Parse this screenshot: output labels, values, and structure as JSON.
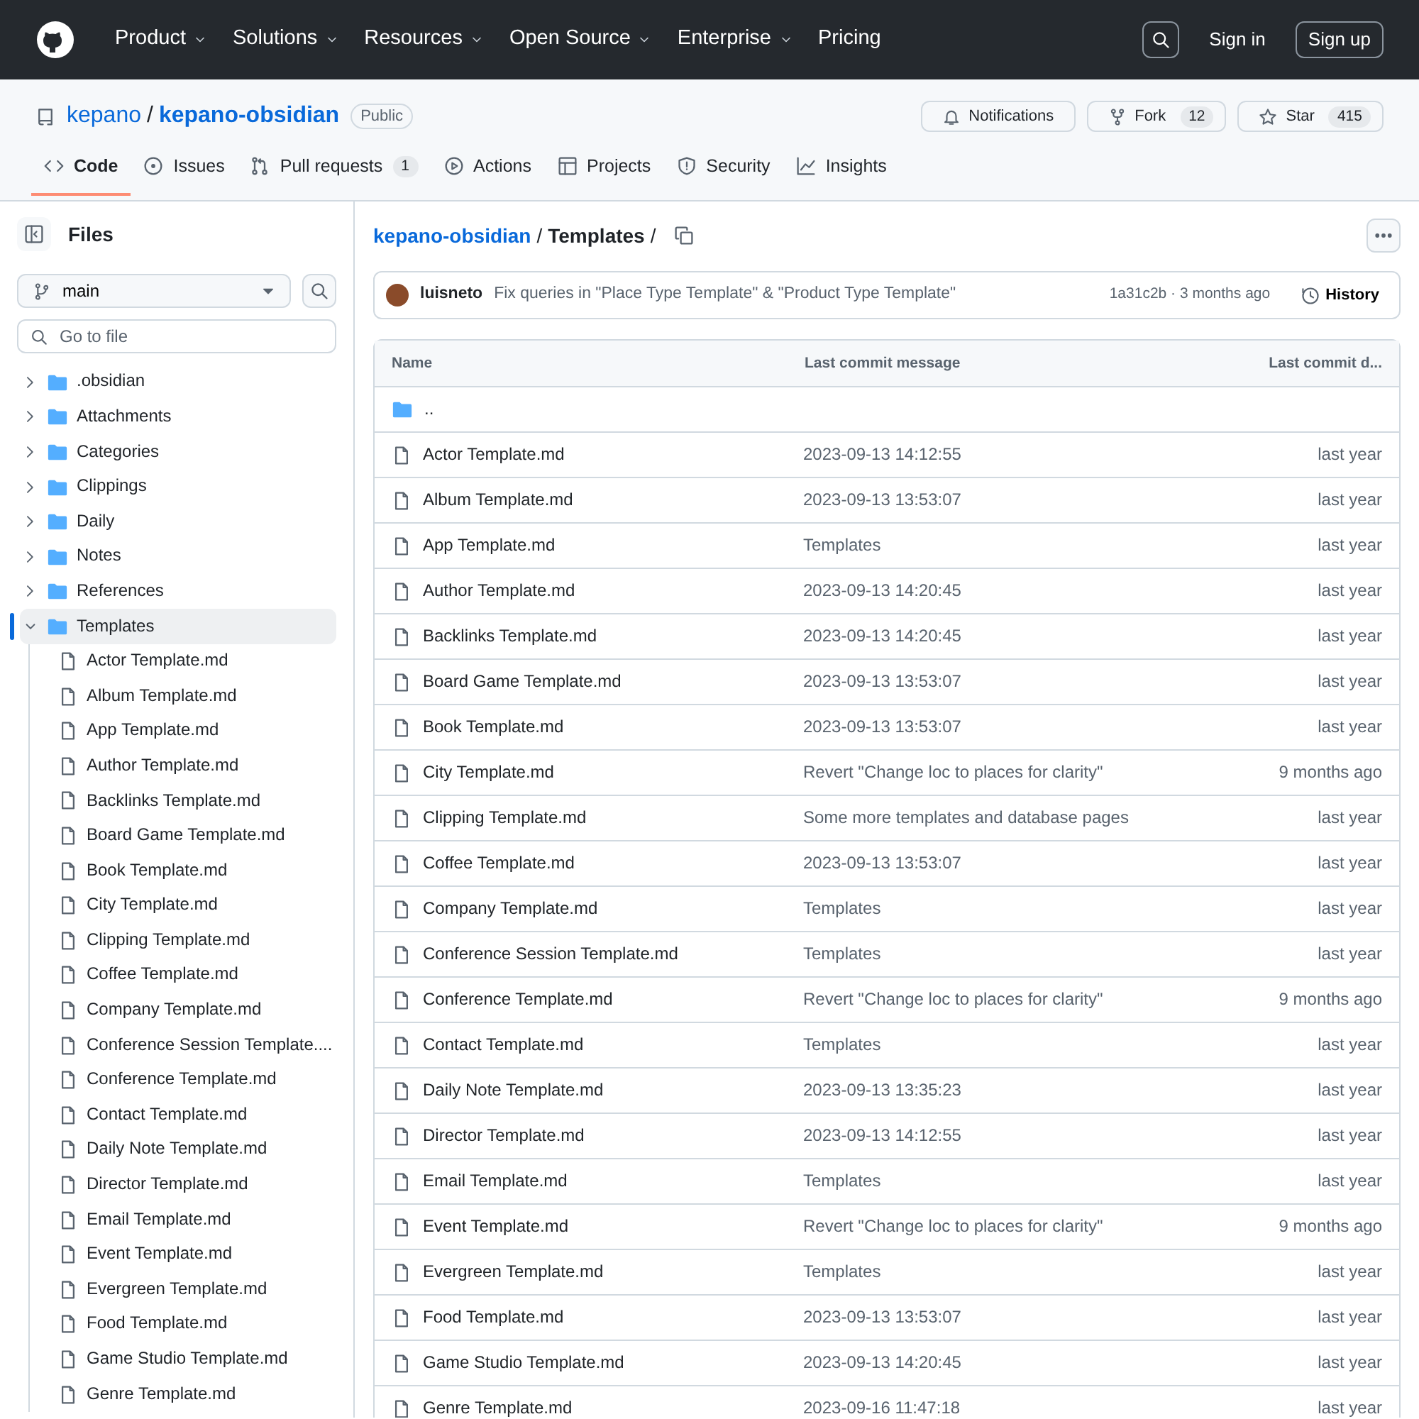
{
  "nav": {
    "items": [
      {
        "label": "Product",
        "dropdown": true
      },
      {
        "label": "Solutions",
        "dropdown": true
      },
      {
        "label": "Resources",
        "dropdown": true
      },
      {
        "label": "Open Source",
        "dropdown": true
      },
      {
        "label": "Enterprise",
        "dropdown": true
      },
      {
        "label": "Pricing",
        "dropdown": false
      }
    ],
    "sign_in": "Sign in",
    "sign_up": "Sign up"
  },
  "repo": {
    "owner": "kepano",
    "separator": "/",
    "name": "kepano-obsidian",
    "visibility": "Public",
    "notifications": "Notifications",
    "fork": {
      "label": "Fork",
      "count": "12"
    },
    "star": {
      "label": "Star",
      "count": "415"
    }
  },
  "tabs": [
    {
      "kind": "code",
      "label": "Code",
      "selected": true
    },
    {
      "kind": "issues",
      "label": "Issues",
      "selected": false
    },
    {
      "kind": "pulls",
      "label": "Pull requests",
      "count": "1",
      "selected": false
    },
    {
      "kind": "actions",
      "label": "Actions",
      "selected": false
    },
    {
      "kind": "projects",
      "label": "Projects",
      "selected": false
    },
    {
      "kind": "security",
      "label": "Security",
      "selected": false
    },
    {
      "kind": "insights",
      "label": "Insights",
      "selected": false
    }
  ],
  "sidebar": {
    "title": "Files",
    "branch": "main",
    "search": {
      "placeholder": "Go to file"
    },
    "tree": [
      {
        "kind": "folder",
        "name": ".obsidian",
        "expanded": false,
        "selected": false
      },
      {
        "kind": "folder",
        "name": "Attachments",
        "expanded": false,
        "selected": false
      },
      {
        "kind": "folder",
        "name": "Categories",
        "expanded": false,
        "selected": false
      },
      {
        "kind": "folder",
        "name": "Clippings",
        "expanded": false,
        "selected": false
      },
      {
        "kind": "folder",
        "name": "Daily",
        "expanded": false,
        "selected": false
      },
      {
        "kind": "folder",
        "name": "Notes",
        "expanded": false,
        "selected": false
      },
      {
        "kind": "folder",
        "name": "References",
        "expanded": false,
        "selected": false
      },
      {
        "kind": "folder",
        "name": "Templates",
        "expanded": true,
        "selected": true,
        "children": [
          {
            "kind": "file",
            "name": "Actor Template.md"
          },
          {
            "kind": "file",
            "name": "Album Template.md"
          },
          {
            "kind": "file",
            "name": "App Template.md"
          },
          {
            "kind": "file",
            "name": "Author Template.md"
          },
          {
            "kind": "file",
            "name": "Backlinks Template.md"
          },
          {
            "kind": "file",
            "name": "Board Game Template.md"
          },
          {
            "kind": "file",
            "name": "Book Template.md"
          },
          {
            "kind": "file",
            "name": "City Template.md"
          },
          {
            "kind": "file",
            "name": "Clipping Template.md"
          },
          {
            "kind": "file",
            "name": "Coffee Template.md"
          },
          {
            "kind": "file",
            "name": "Company Template.md"
          },
          {
            "kind": "file",
            "name": "Conference Session Template...."
          },
          {
            "kind": "file",
            "name": "Conference Template.md"
          },
          {
            "kind": "file",
            "name": "Contact Template.md"
          },
          {
            "kind": "file",
            "name": "Daily Note Template.md"
          },
          {
            "kind": "file",
            "name": "Director Template.md"
          },
          {
            "kind": "file",
            "name": "Email Template.md"
          },
          {
            "kind": "file",
            "name": "Event Template.md"
          },
          {
            "kind": "file",
            "name": "Evergreen Template.md"
          },
          {
            "kind": "file",
            "name": "Food Template.md"
          },
          {
            "kind": "file",
            "name": "Game Studio Template.md"
          },
          {
            "kind": "file",
            "name": "Genre Template.md"
          }
        ]
      }
    ]
  },
  "breadcrumb": {
    "parts": [
      "kepano-obsidian",
      "Templates"
    ],
    "separator": "/"
  },
  "commit": {
    "author": "luisneto",
    "message": "Fix queries in \"Place Type Template\" & \"Product Type Template\"",
    "sha_time": "1a31c2b · 3 months ago",
    "history": "History"
  },
  "table": {
    "columns": [
      "Name",
      "Last commit message",
      "Last commit d..."
    ],
    "parent": "..",
    "rows": [
      {
        "name": "Actor Template.md",
        "message": "2023-09-13 14:12:55",
        "date": "last year"
      },
      {
        "name": "Album Template.md",
        "message": "2023-09-13 13:53:07",
        "date": "last year"
      },
      {
        "name": "App Template.md",
        "message": "Templates",
        "date": "last year"
      },
      {
        "name": "Author Template.md",
        "message": "2023-09-13 14:20:45",
        "date": "last year"
      },
      {
        "name": "Backlinks Template.md",
        "message": "2023-09-13 14:20:45",
        "date": "last year"
      },
      {
        "name": "Board Game Template.md",
        "message": "2023-09-13 13:53:07",
        "date": "last year"
      },
      {
        "name": "Book Template.md",
        "message": "2023-09-13 13:53:07",
        "date": "last year"
      },
      {
        "name": "City Template.md",
        "message": "Revert \"Change loc to places for clarity\"",
        "date": "9 months ago"
      },
      {
        "name": "Clipping Template.md",
        "message": "Some more templates and database pages",
        "date": "last year"
      },
      {
        "name": "Coffee Template.md",
        "message": "2023-09-13 13:53:07",
        "date": "last year"
      },
      {
        "name": "Company Template.md",
        "message": "Templates",
        "date": "last year"
      },
      {
        "name": "Conference Session Template.md",
        "message": "Templates",
        "date": "last year"
      },
      {
        "name": "Conference Template.md",
        "message": "Revert \"Change loc to places for clarity\"",
        "date": "9 months ago"
      },
      {
        "name": "Contact Template.md",
        "message": "Templates",
        "date": "last year"
      },
      {
        "name": "Daily Note Template.md",
        "message": "2023-09-13 13:35:23",
        "date": "last year"
      },
      {
        "name": "Director Template.md",
        "message": "2023-09-13 14:12:55",
        "date": "last year"
      },
      {
        "name": "Email Template.md",
        "message": "Templates",
        "date": "last year"
      },
      {
        "name": "Event Template.md",
        "message": "Revert \"Change loc to places for clarity\"",
        "date": "9 months ago"
      },
      {
        "name": "Evergreen Template.md",
        "message": "Templates",
        "date": "last year"
      },
      {
        "name": "Food Template.md",
        "message": "2023-09-13 13:53:07",
        "date": "last year"
      },
      {
        "name": "Game Studio Template.md",
        "message": "2023-09-13 14:20:45",
        "date": "last year"
      },
      {
        "name": "Genre Template.md",
        "message": "2023-09-16 11:47:18",
        "date": "last year"
      }
    ]
  }
}
